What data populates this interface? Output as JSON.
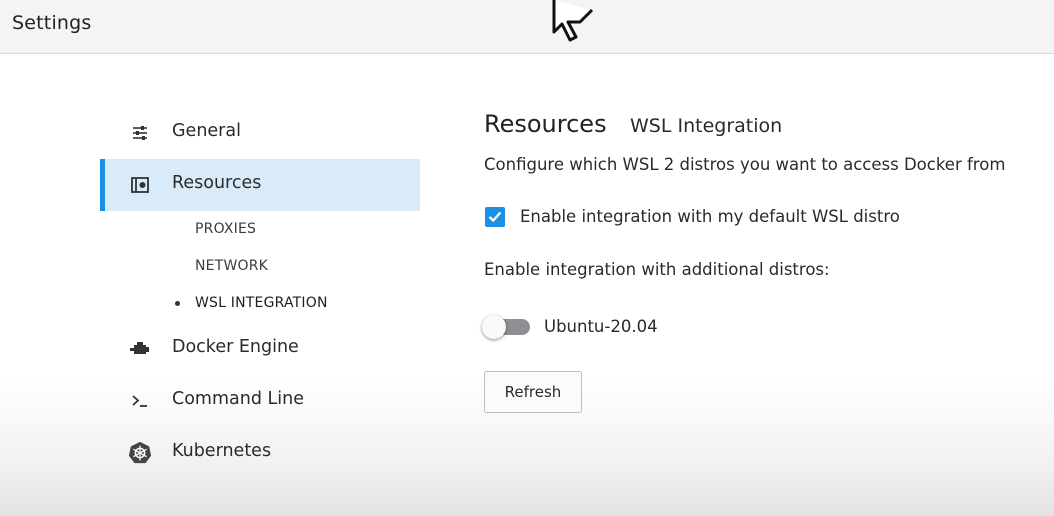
{
  "window": {
    "title": "Settings"
  },
  "sidebar": {
    "items": [
      {
        "label": "General",
        "icon": "sliders-icon"
      },
      {
        "label": "Resources",
        "icon": "resources-icon",
        "active": true
      },
      {
        "label": "Docker Engine",
        "icon": "engine-icon"
      },
      {
        "label": "Command Line",
        "icon": "terminal-icon"
      },
      {
        "label": "Kubernetes",
        "icon": "kubernetes-icon"
      }
    ],
    "subitems": [
      {
        "label": "PROXIES"
      },
      {
        "label": "NETWORK"
      },
      {
        "label": "WSL INTEGRATION",
        "current": true
      }
    ]
  },
  "main": {
    "breadcrumb": {
      "section": "Resources",
      "page": "WSL Integration"
    },
    "description": "Configure which WSL 2 distros you want to access Docker from",
    "default_integration": {
      "label": "Enable integration with my default WSL distro",
      "checked": true
    },
    "additional_label": "Enable integration with additional distros:",
    "distros": [
      {
        "name": "Ubuntu-20.04",
        "enabled": false
      }
    ],
    "refresh_label": "Refresh"
  },
  "colors": {
    "accent": "#1d8fe0",
    "active_bg": "#d9ebf9"
  }
}
